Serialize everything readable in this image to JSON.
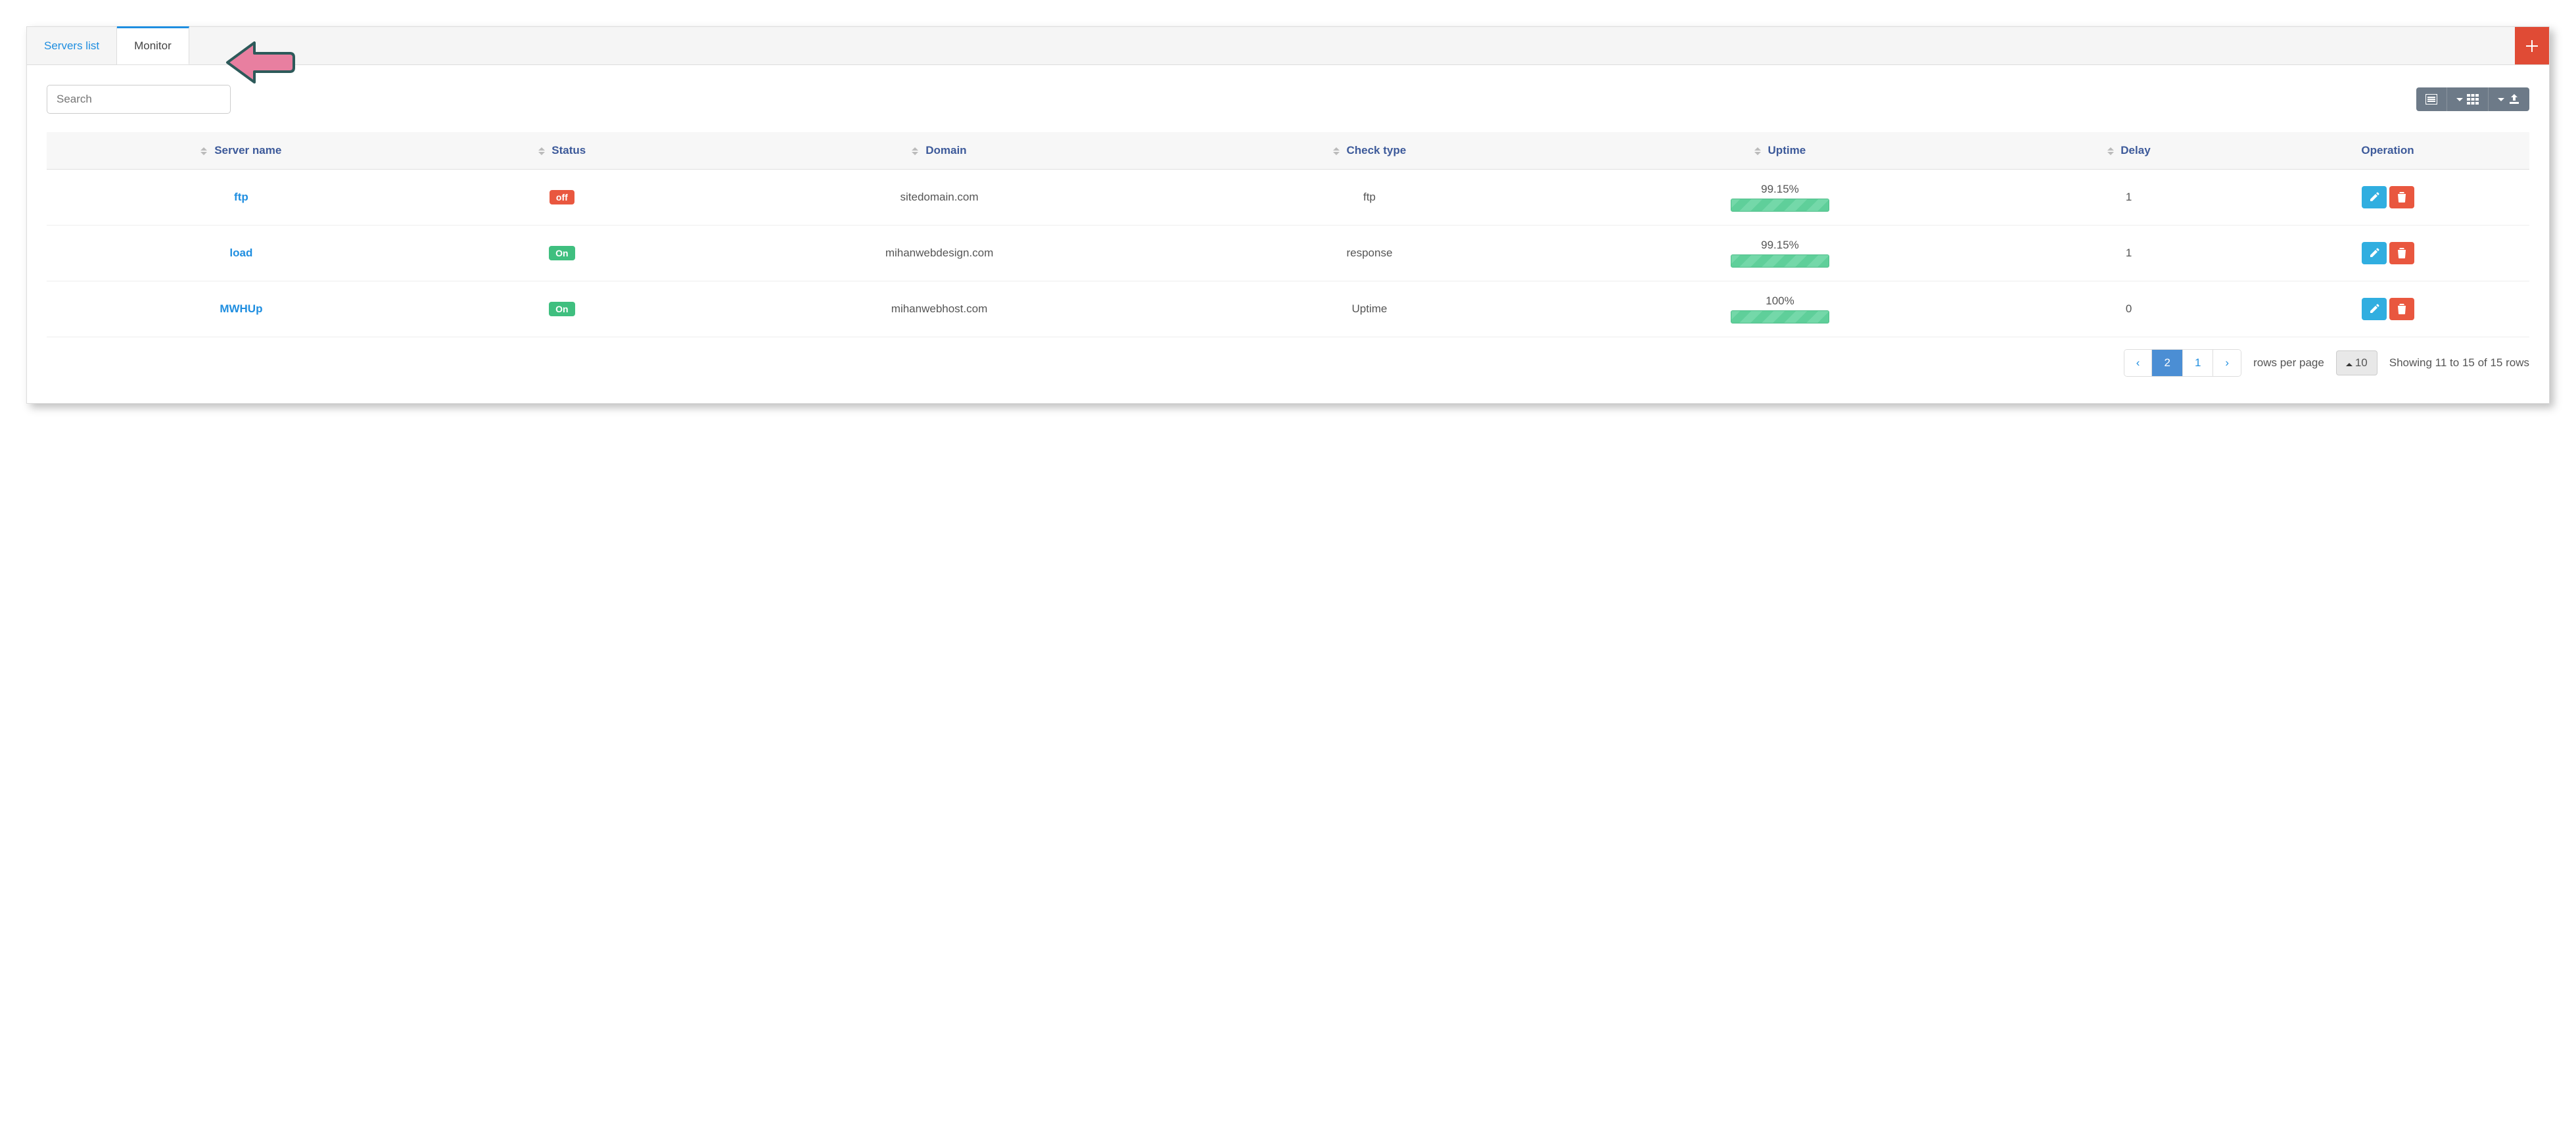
{
  "tabs": {
    "servers_list": "Servers list",
    "monitor": "Monitor"
  },
  "active_tab": "monitor",
  "search": {
    "placeholder": "Search"
  },
  "columns": {
    "server_name": "Server name",
    "status": "Status",
    "domain": "Domain",
    "check_type": "Check type",
    "uptime": "Uptime",
    "delay": "Delay",
    "operation": "Operation"
  },
  "status_labels": {
    "on": "On",
    "off": "off"
  },
  "rows": [
    {
      "name": "ftp",
      "status": "off",
      "domain": "sitedomain.com",
      "check_type": "ftp",
      "uptime": "99.15%",
      "delay": "1"
    },
    {
      "name": "load",
      "status": "on",
      "domain": "mihanwebdesign.com",
      "check_type": "response",
      "uptime": "99.15%",
      "delay": "1"
    },
    {
      "name": "MWHUp",
      "status": "on",
      "domain": "mihanwebhost.com",
      "check_type": "Uptime",
      "uptime": "100%",
      "delay": "0"
    }
  ],
  "pagination": {
    "prev": "‹",
    "next": "›",
    "pages": [
      "2",
      "1"
    ],
    "active_page": "2",
    "rows_per_page_label": "rows per page",
    "rows_per_page_value": "10",
    "summary": "Showing 11 to 15 of 15 rows"
  }
}
